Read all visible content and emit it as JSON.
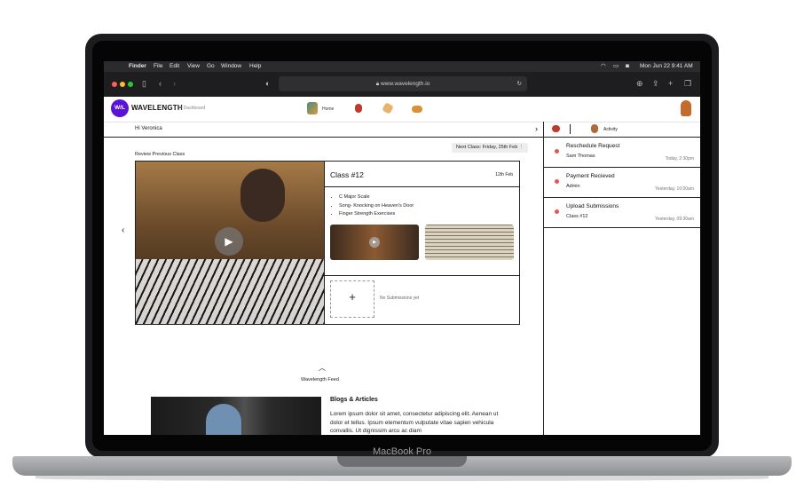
{
  "device": {
    "label": "MacBook Pro"
  },
  "menubar": {
    "apple": "",
    "items": [
      "Finder",
      "File",
      "Edit",
      "View",
      "Go",
      "Window",
      "Help"
    ],
    "datetime": "Mon Jun 22  9:41 AM"
  },
  "browser": {
    "url": "www.wavelength.io"
  },
  "app": {
    "logo": "W/L",
    "brand": "WAVELENGTH",
    "section": "| Dashboard",
    "nav_home": "Home",
    "greeting": "Hi Veronica",
    "review_label": "Review Previous Class",
    "next_class": "Next Class: Friday, 25th Feb",
    "class": {
      "title": "Class #12",
      "date": "12th Feb",
      "topics": [
        "C Major Scale",
        "Song- Knocking on Heaven's Door",
        "Finger Strength Exercises"
      ],
      "add_symbol": "+",
      "no_submissions": "No Submissions yet"
    },
    "feed_label": "Wavelength Feed",
    "blog": {
      "title": "Blogs & Articles",
      "body": "Lorem ipsum dolor sit amet, consectetur adipiscing elit. Aenean ut dolor et tellus. Ipsum elementum vulputate vitae sapien vehicula convallis. Ut dignissim arcu ac diam"
    },
    "activity": {
      "header": "Activity",
      "items": [
        {
          "title": "Reschedule Request",
          "sub": "Sam Thomas",
          "time": "Today, 2:30pm"
        },
        {
          "title": "Payment Recieved",
          "sub": "Admin",
          "time": "Yesterday, 10:00am"
        },
        {
          "title": "Upload Submissions",
          "sub": "Class #12",
          "time": "Yesterday, 09:30am"
        }
      ]
    }
  },
  "colors": {
    "brand": "#5a12d6",
    "activity_dot": "#e0594f"
  }
}
